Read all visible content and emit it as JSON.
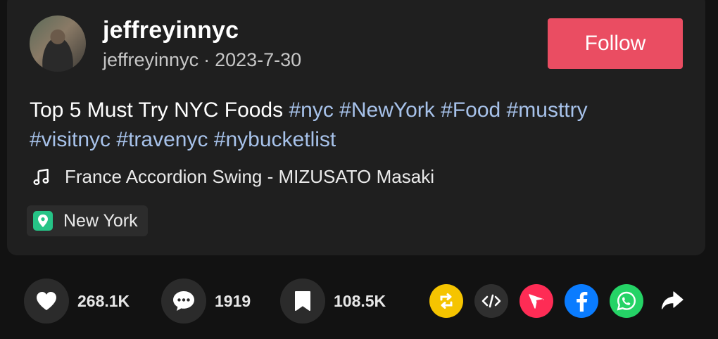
{
  "post": {
    "username": "jeffreyinnyc",
    "handle": "jeffreyinnyc",
    "separator": "·",
    "date": "2023-7-30",
    "follow_label": "Follow",
    "description_text": "Top 5 Must Try NYC Foods ",
    "hashtags": [
      "#nyc",
      "#NewYork",
      "#Food",
      "#musttry",
      "#visitnyc",
      "#travenyc",
      "#nybucketlist"
    ],
    "music": "France Accordion Swing - MIZUSATO Masaki",
    "location": "New York"
  },
  "actions": {
    "likes": "268.1K",
    "comments": "1919",
    "saves": "108.5K"
  },
  "share_icons": [
    "repost-icon",
    "embed-icon",
    "send-icon",
    "facebook-icon",
    "whatsapp-icon",
    "share-arrow-icon"
  ],
  "colors": {
    "follow": "#ea4d62",
    "hashtag": "#a7c2ea",
    "repost": "#f5c400",
    "embed": "#2f2f2f",
    "send": "#fe2c55",
    "facebook": "#0a7cff",
    "whatsapp": "#25d366",
    "location_pin": "#26c487"
  }
}
